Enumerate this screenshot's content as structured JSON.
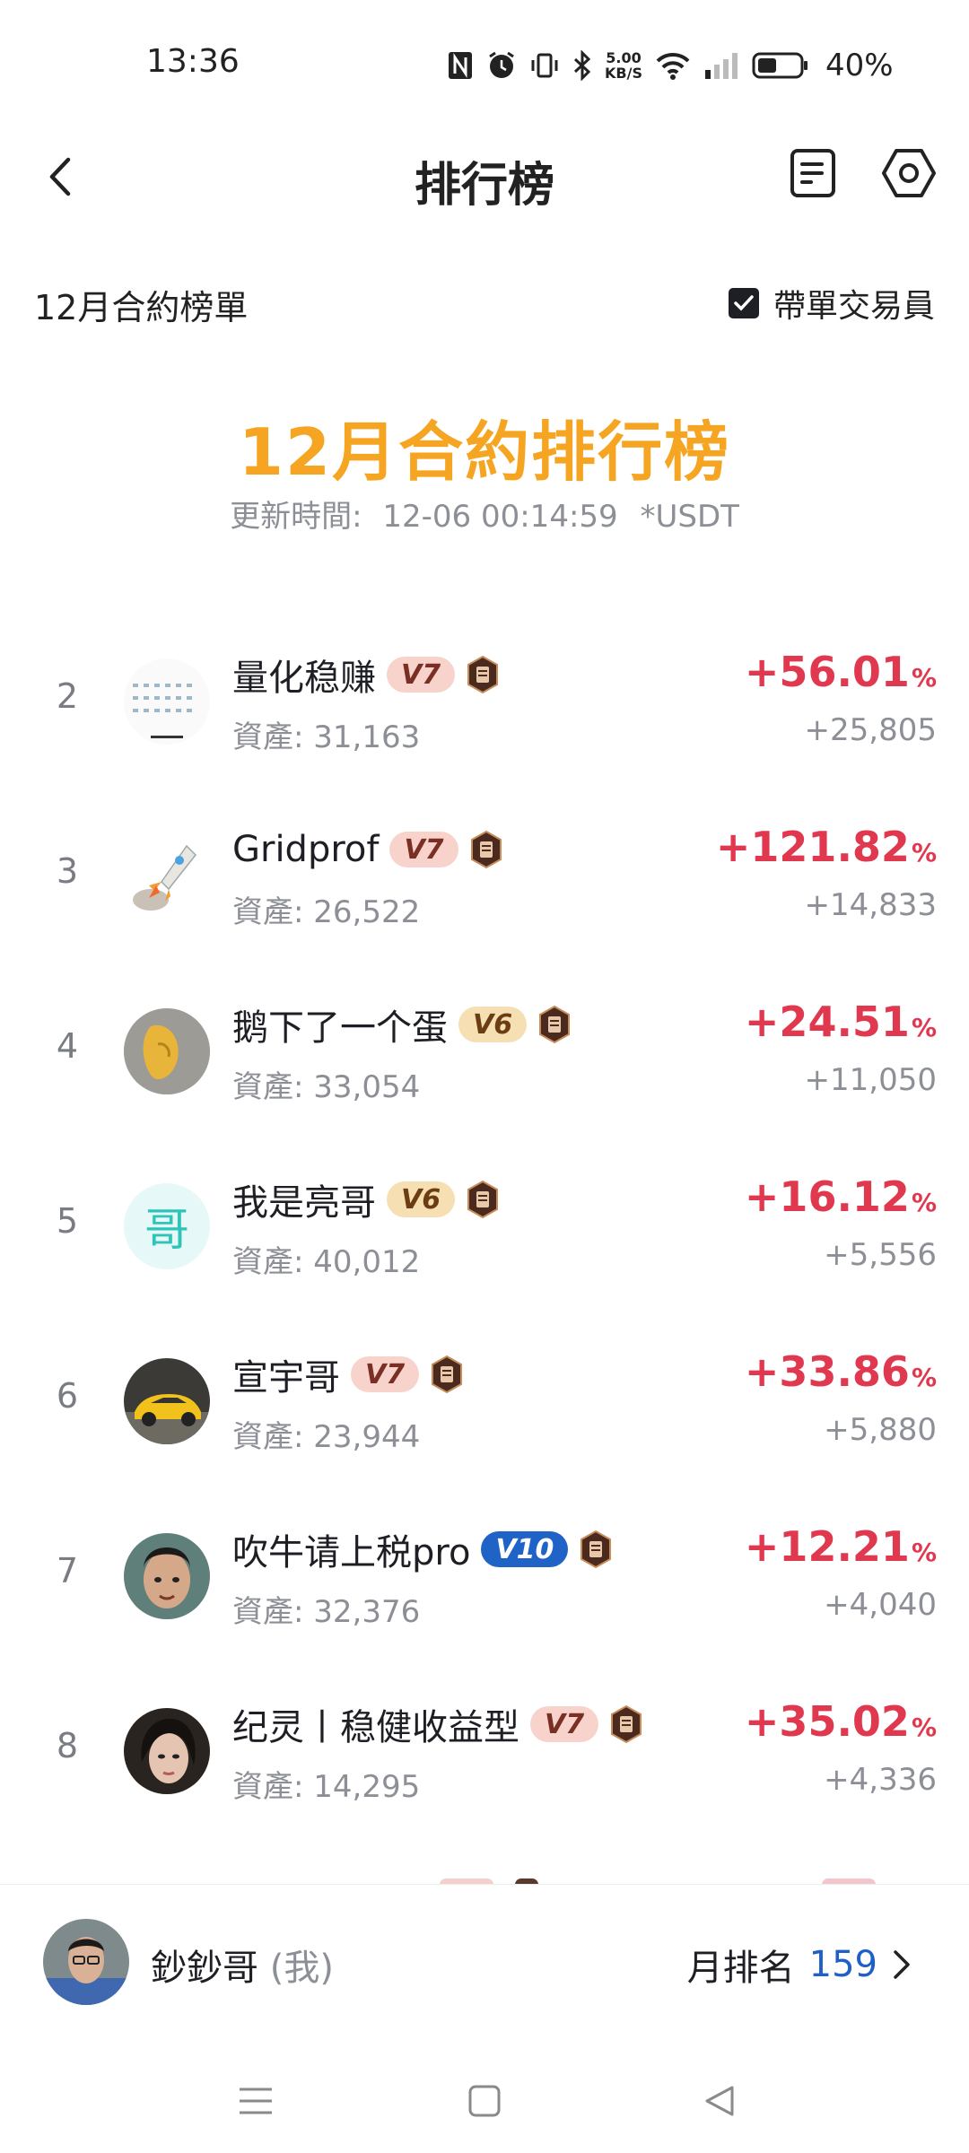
{
  "status_bar": {
    "time": "13:36",
    "net_speed_top": "5.00",
    "net_speed_bottom": "KB/S",
    "battery_pct": "40%"
  },
  "header": {
    "title": "排行榜",
    "back_icon": "chevron-left-icon",
    "doc_icon": "document-icon",
    "settings_icon": "settings-icon"
  },
  "subheader": {
    "board_name": "12月合約榜單",
    "toggle_label": "帶單交易員",
    "toggle_checked": true
  },
  "banner": {
    "title": "12月合約排行榜",
    "update_label": "更新時間:",
    "update_time": "12-06 00:14:59",
    "unit": "*USDT"
  },
  "rows": [
    {
      "rank": "2",
      "name": "量化稳赚",
      "vip": "V7",
      "assets": "資產: 31,163",
      "roi": "+56.01",
      "profit": "+25,805"
    },
    {
      "rank": "3",
      "name": "Gridprof",
      "vip": "V7",
      "assets": "資產: 26,522",
      "roi": "+121.82",
      "profit": "+14,833"
    },
    {
      "rank": "4",
      "name": "鹅下了一个蛋",
      "vip": "V6",
      "assets": "資產: 33,054",
      "roi": "+24.51",
      "profit": "+11,050"
    },
    {
      "rank": "5",
      "name": "我是亮哥",
      "vip": "V6",
      "assets": "資產: 40,012",
      "roi": "+16.12",
      "profit": "+5,556",
      "avatar_text": "哥"
    },
    {
      "rank": "6",
      "name": "宣宇哥",
      "vip": "V7",
      "assets": "資產: 23,944",
      "roi": "+33.86",
      "profit": "+5,880"
    },
    {
      "rank": "7",
      "name": "吹牛请上税pro",
      "vip": "V10",
      "assets": "資產: 32,376",
      "roi": "+12.21",
      "profit": "+4,040"
    },
    {
      "rank": "8",
      "name": "纪灵丨稳健收益型",
      "vip": "V7",
      "assets": "資產: 14,295",
      "roi": "+35.02",
      "profit": "+4,336"
    }
  ],
  "pct_sign": "%",
  "my_rank": {
    "name": "鈔鈔哥",
    "me_tag": "(我)",
    "label": "月排名",
    "value": "159"
  },
  "colors": {
    "accent_orange": "#f5a521",
    "profit_red": "#e0384f",
    "rank_blue": "#1f5fc8"
  }
}
